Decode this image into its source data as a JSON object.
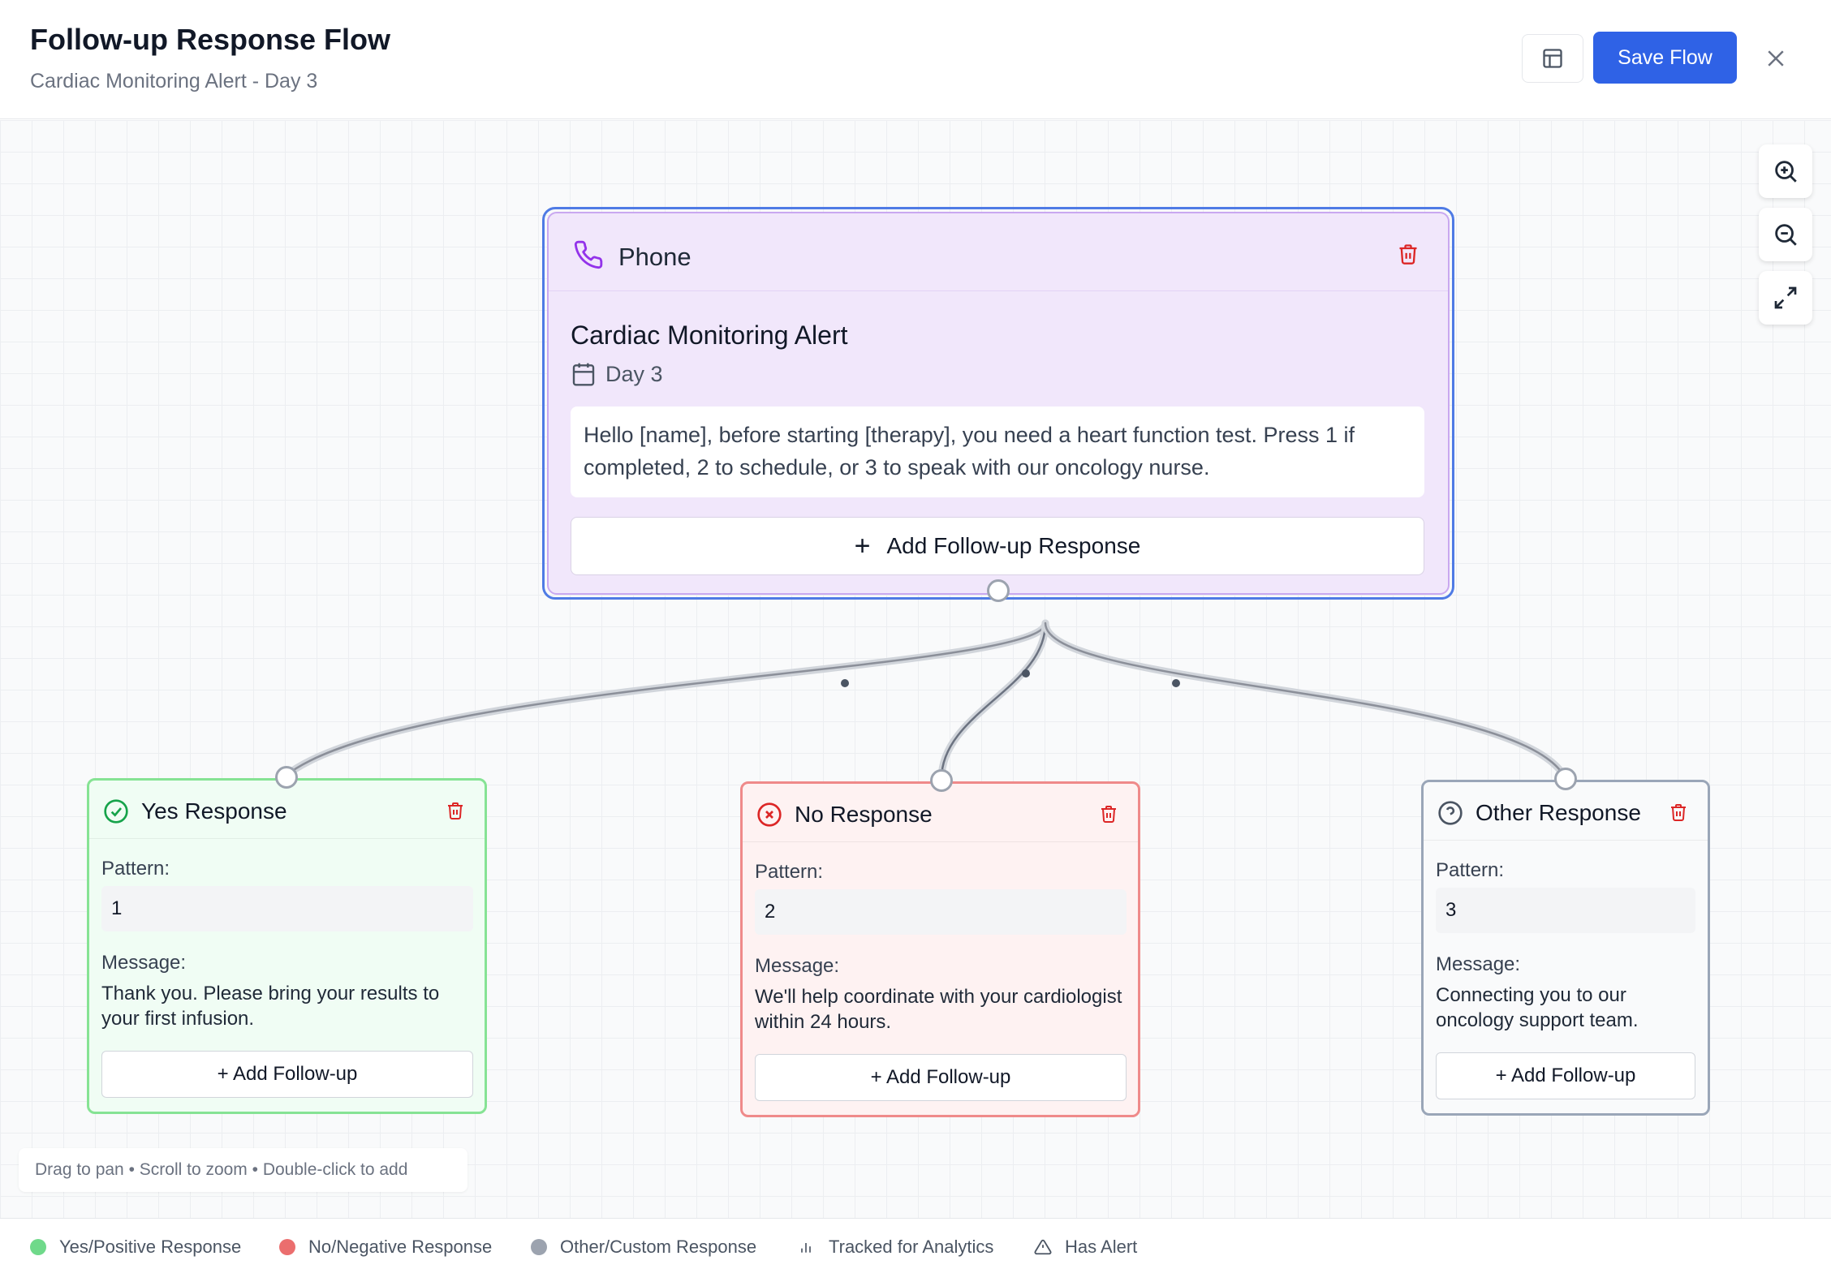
{
  "header": {
    "title": "Follow-up Response Flow",
    "subtitle": "Cardiac Monitoring Alert - Day 3",
    "save_label": "Save Flow"
  },
  "main_node": {
    "type": "Phone",
    "title": "Cardiac Monitoring Alert",
    "day": "Day 3",
    "message": "Hello [name], before starting [therapy], you need a heart function test. Press 1 if completed, 2 to schedule, or 3 to speak with our oncology nurse.",
    "add_label": "Add Follow-up Response"
  },
  "responses": [
    {
      "title": "Yes Response",
      "pattern_label": "Pattern:",
      "pattern": "1",
      "message_label": "Message:",
      "message": "Thank you. Please bring your results to your first infusion.",
      "add_label": "+ Add Follow-up",
      "color": "#86e394"
    },
    {
      "title": "No Response",
      "pattern_label": "Pattern:",
      "pattern": "2",
      "message_label": "Message:",
      "message": "We'll help coordinate with your cardiologist within 24 hours.",
      "add_label": "+ Add Follow-up",
      "color": "#ef8a8a"
    },
    {
      "title": "Other Response",
      "pattern_label": "Pattern:",
      "pattern": "3",
      "message_label": "Message:",
      "message": "Connecting you to our oncology support team.",
      "add_label": "+ Add Follow-up",
      "color": "#9aa6b8"
    }
  ],
  "hint": "Drag to pan • Scroll to zoom • Double-click to add",
  "legend": [
    {
      "label": "Yes/Positive Response",
      "color": "#6fd98a"
    },
    {
      "label": "No/Negative Response",
      "color": "#eb6e6e"
    },
    {
      "label": "Other/Custom Response",
      "color": "#9ca3af"
    },
    {
      "label": "Tracked for Analytics",
      "icon": "bar-chart-icon"
    },
    {
      "label": "Has Alert",
      "icon": "warning-icon"
    }
  ]
}
